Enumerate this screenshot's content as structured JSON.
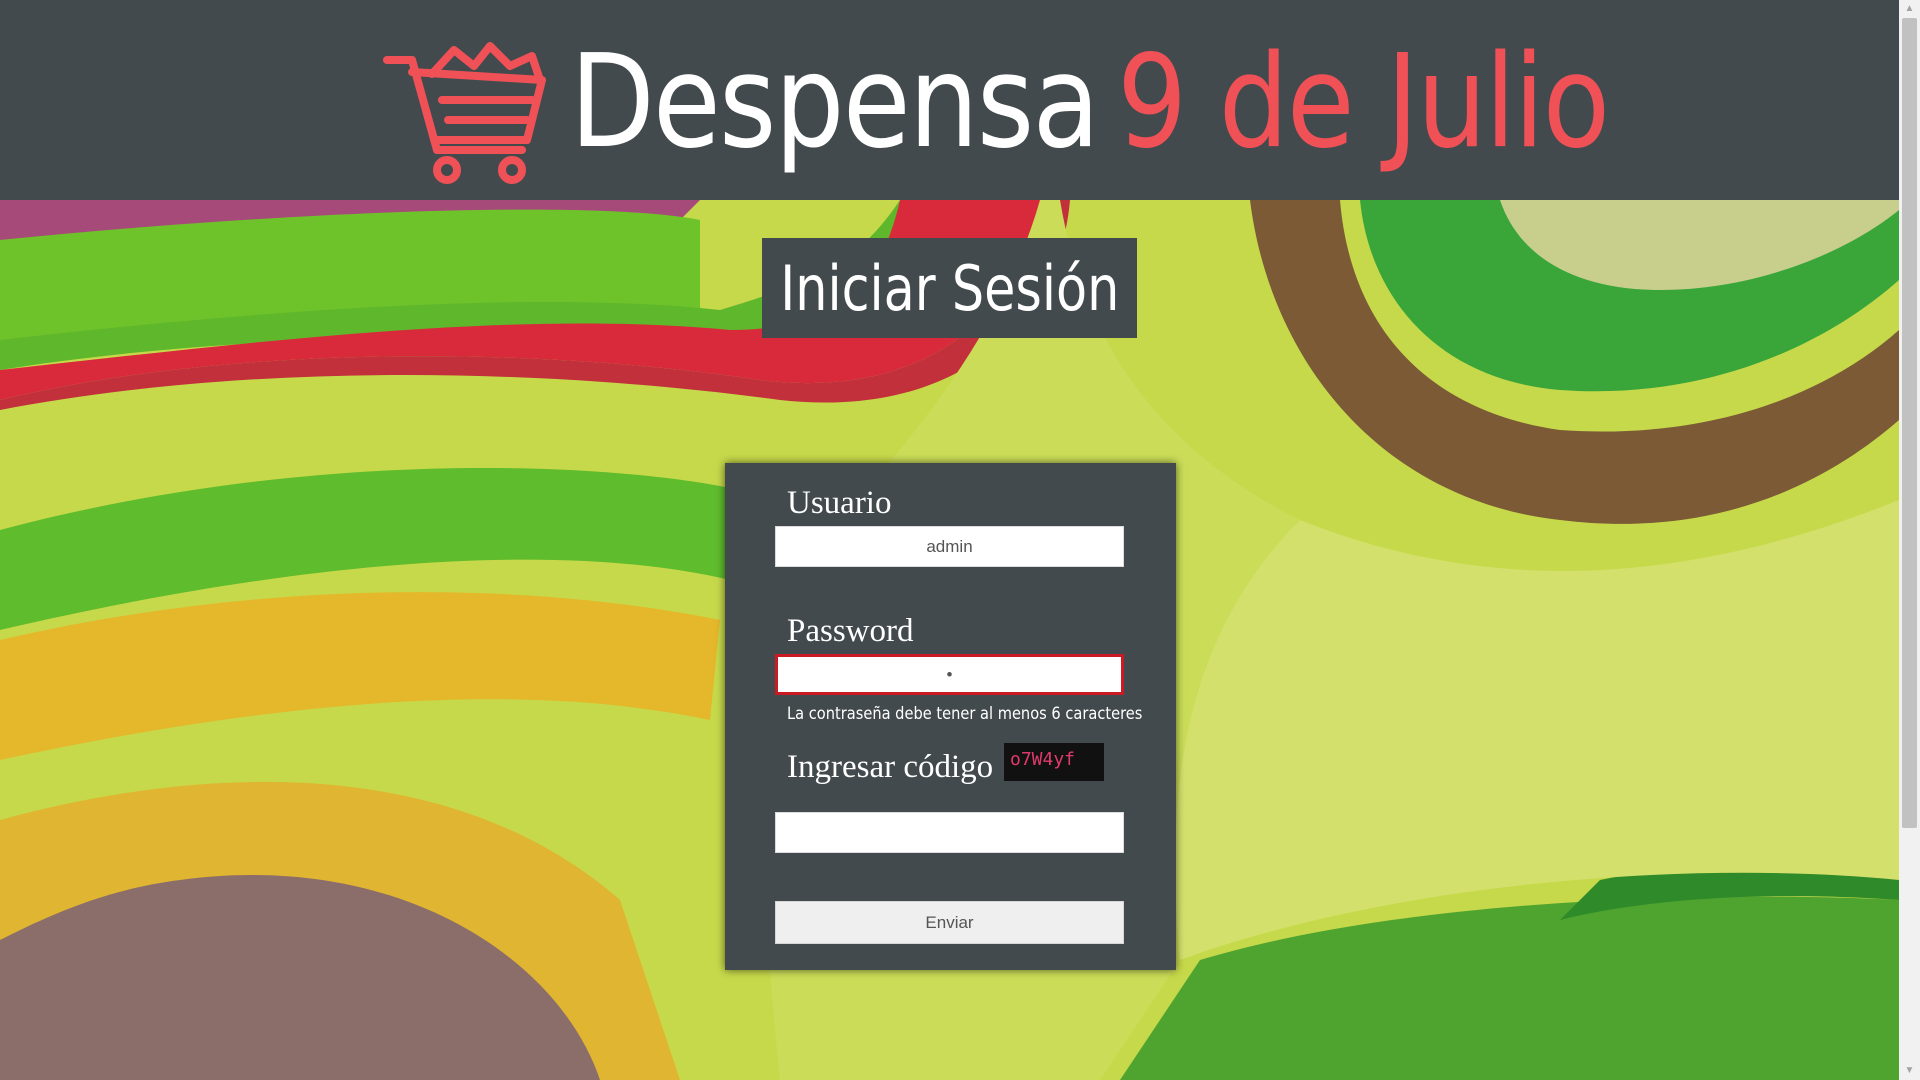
{
  "header": {
    "brand_primary": "Despensa",
    "brand_accent": "9 de Julio",
    "logo_icon": "shopping-cart-icon",
    "bg_color": "#434a4d",
    "accent_color": "#f05157"
  },
  "page": {
    "title": "Iniciar Sesión"
  },
  "login": {
    "username_label": "Usuario",
    "username_value": "admin",
    "password_label": "Password",
    "password_value": "•",
    "password_error": "La contraseña debe tener al menos 6 caracteres",
    "captcha_label": "Ingresar código",
    "captcha_code": "o7W4yf",
    "captcha_value": "",
    "submit_label": "Enviar",
    "error_color": "#cc1a24"
  }
}
